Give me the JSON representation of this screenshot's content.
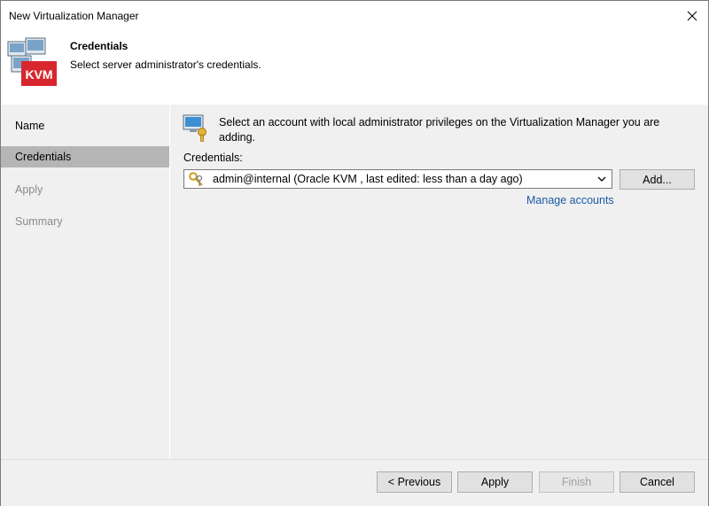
{
  "window": {
    "title": "New Virtualization Manager"
  },
  "header": {
    "title": "Credentials",
    "subtitle": "Select server administrator's credentials.",
    "badge": "KVM"
  },
  "steps": [
    {
      "label": "Name",
      "state": "done"
    },
    {
      "label": "Credentials",
      "state": "active"
    },
    {
      "label": "Apply",
      "state": "disabled"
    },
    {
      "label": "Summary",
      "state": "disabled"
    }
  ],
  "content": {
    "info_text": "Select an account with local administrator privileges on the Virtualization Manager you are adding.",
    "credentials_label": "Credentials:",
    "credentials_value": "admin@internal (Oracle KVM , last edited: less than a day ago)",
    "add_label": "Add...",
    "manage_label": "Manage accounts"
  },
  "footer": {
    "previous_label": "< Previous",
    "apply_label": "Apply",
    "finish_label": "Finish",
    "cancel_label": "Cancel"
  },
  "icons": {
    "close": "close-icon",
    "header": "kvm-servers-icon",
    "info": "computer-key-icon",
    "key": "key-icon",
    "dropdown": "chevron-down-icon"
  },
  "colors": {
    "active_step": "#b5b5b5",
    "panel": "#f0f0f0",
    "link": "#1a5aa8",
    "kvm_badge": "#d8262e"
  }
}
